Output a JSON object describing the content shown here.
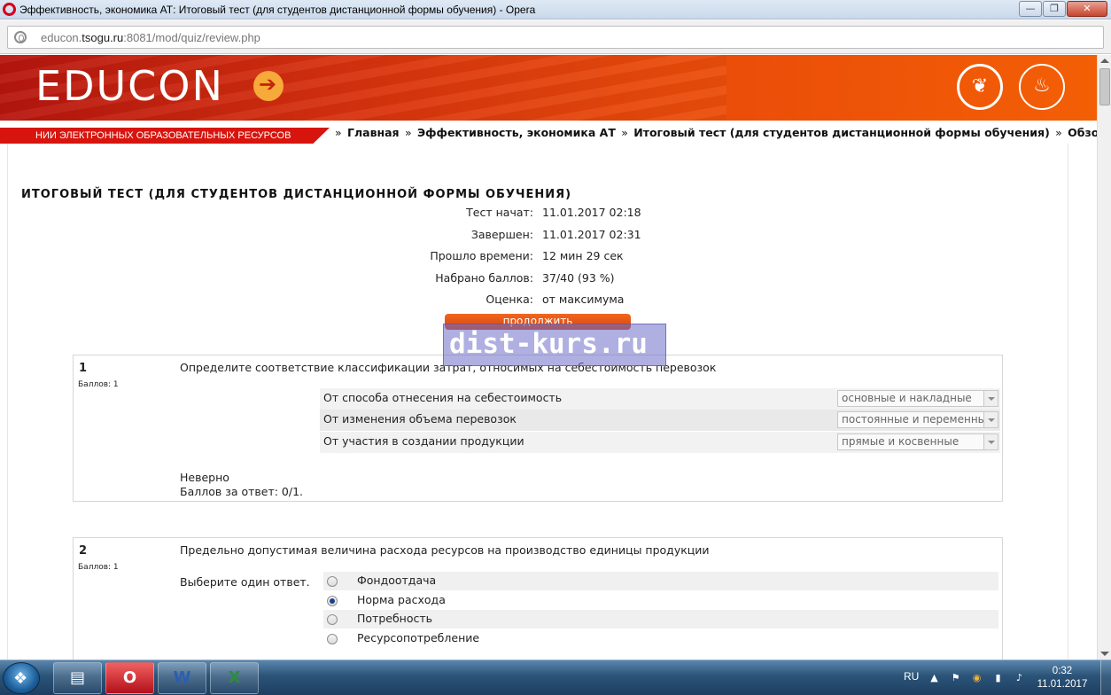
{
  "window": {
    "title": "Эффективность, экономика АТ: Итоговый тест (для студентов дистанционной формы обучения) - Opera",
    "min_symbol": "—",
    "max_symbol": "❐",
    "close_symbol": "✕"
  },
  "address": {
    "url_prefix": "educon.",
    "url_host": "tsogu.ru",
    "url_rest": ":8081/mod/quiz/review.php"
  },
  "header": {
    "logo": "EDUCON",
    "institute_label": "НИИ ЭЛЕКТРОННЫХ ОБРАЗОВАТЕЛЬНЫХ РЕСУРСОВ",
    "emblem_icons": [
      "bird-emblem-icon",
      "university-emblem-icon"
    ]
  },
  "breadcrumb": {
    "sep": "»",
    "items": [
      "Главная",
      "Эффективность, экономика АТ",
      "Итоговый тест (для студентов дистанционной формы обучения)",
      "Обзор"
    ]
  },
  "quiz": {
    "title": "ИТОГОВЫЙ ТЕСТ (ДЛЯ СТУДЕНТОВ ДИСТАНЦИОННОЙ ФОРМЫ ОБУЧЕНИЯ)",
    "summary": [
      {
        "label": "Тест начат:",
        "value": "11.01.2017 02:18"
      },
      {
        "label": "Завершен:",
        "value": "11.01.2017 02:31"
      },
      {
        "label": "Прошло времени:",
        "value": "12 мин 29 сек"
      },
      {
        "label": "Набрано баллов:",
        "value": "37/40 (93 %)"
      },
      {
        "label": "Оценка:",
        "value": "от максимума"
      }
    ],
    "continue_label": "продолжить"
  },
  "watermark": "dist-kurs.ru",
  "questions": [
    {
      "number": "1",
      "points": "Баллов: 1",
      "text": "Определите соответствие классификации затрат, относимых на себестоимость перевозок",
      "matches": [
        {
          "label": "От способа отнесения на себестоимость",
          "selected": "основные и накладные"
        },
        {
          "label": "От изменения объема перевозок",
          "selected": "постоянные и переменные"
        },
        {
          "label": "От участия в создании продукции",
          "selected": "прямые и косвенные"
        }
      ],
      "result": "Неверно",
      "score": "Баллов за ответ: 0/1."
    },
    {
      "number": "2",
      "points": "Баллов: 1",
      "text": "Предельно допустимая величина расхода ресурсов на производство единицы продукции",
      "choose_label": "Выберите один ответ.",
      "options": [
        {
          "label": "Фондоотдача",
          "checked": false
        },
        {
          "label": "Норма расхода",
          "checked": true
        },
        {
          "label": "Потребность",
          "checked": false
        },
        {
          "label": "Ресурсопотребление",
          "checked": false
        }
      ]
    }
  ],
  "taskbar": {
    "start_symbol": "❖",
    "apps": [
      {
        "name": "explorer",
        "symbol": "▤"
      },
      {
        "name": "opera",
        "symbol": "O"
      },
      {
        "name": "word",
        "symbol": "W"
      },
      {
        "name": "excel",
        "symbol": "X"
      }
    ],
    "language": "RU",
    "tray_icons": [
      "▲",
      "⚑",
      "◉",
      "▮",
      "♪"
    ],
    "time": "0:32",
    "date": "11.01.2017"
  },
  "colors": {
    "brand_red": "#d7150e",
    "brand_orange": "#f35f05",
    "button_orange": "#e8551a",
    "watermark_bg": "#6e6ec8"
  }
}
